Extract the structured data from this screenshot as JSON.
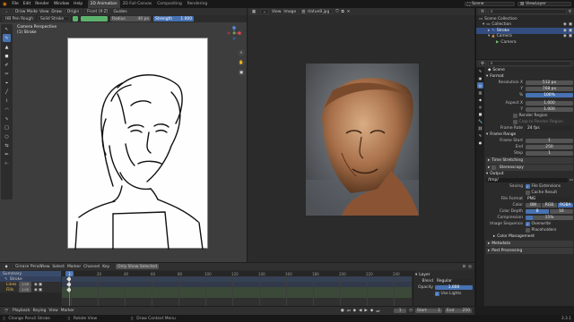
{
  "menu": [
    "File",
    "Edit",
    "Render",
    "Window",
    "Help"
  ],
  "workspace_tabs": [
    {
      "label": "2D Animation",
      "active": true
    },
    {
      "label": "2D Full Canvas",
      "active": false
    },
    {
      "label": "Compositing",
      "active": false
    },
    {
      "label": "Rendering",
      "active": false
    }
  ],
  "topbar_right": {
    "scene": "Scene",
    "view_layer": "ViewLayer"
  },
  "left_header": {
    "mode": "Draw Mode",
    "view": "View",
    "draw": "Draw",
    "origin": "Origin",
    "front": "Front (X-Z)",
    "guides": "Guides"
  },
  "tool_header": {
    "brush": "HB Pen Rough",
    "stroke": "Solid Stroke",
    "radius_label": "Radius",
    "radius_value": "40 px",
    "strength_label": "Strength",
    "strength_value": "1.000"
  },
  "viewport_info": {
    "line1": "Camera Perspective",
    "line2": "(1) Stroke"
  },
  "image_editor": {
    "view": "View",
    "image": "Image",
    "filename": "statue8.jpg"
  },
  "outliner": {
    "title": "Scene Collection",
    "items": [
      {
        "label": "Collection",
        "depth": 1,
        "selected": false
      },
      {
        "label": "Stroke",
        "depth": 2,
        "selected": true
      },
      {
        "label": "Camera",
        "depth": 1,
        "selected": false
      },
      {
        "label": "Camera",
        "depth": 2,
        "selected": false
      }
    ]
  },
  "properties": {
    "header": "Scene",
    "format": {
      "title": "Format",
      "rows": [
        {
          "label": "Resolution X",
          "value": "512 px",
          "blue": false
        },
        {
          "label": "Y",
          "value": "768 px",
          "blue": false
        },
        {
          "label": "%",
          "value": "100%",
          "blue": true
        },
        {
          "label": "Aspect X",
          "value": "1.000",
          "blue": false
        },
        {
          "label": "Y",
          "value": "1.000",
          "blue": false
        }
      ],
      "render_region": "Render Region",
      "crop_region": "Crop to Render Region",
      "frame_rate_label": "Frame Rate",
      "frame_rate_value": "24 fps"
    },
    "frame_range": {
      "title": "Frame Range",
      "rows": [
        {
          "label": "Frame Start",
          "value": "1"
        },
        {
          "label": "End",
          "value": "250"
        },
        {
          "label": "Step",
          "value": "1"
        }
      ]
    },
    "time_stretching": "Time Stretching",
    "stereoscopy": "Stereoscopy",
    "output": {
      "title": "Output",
      "path": "/tmp/",
      "saving_label": "Saving",
      "file_extensions": "File Extensions",
      "cache_result": "Cache Result",
      "file_format_label": "File Format",
      "file_format_value": "PNG",
      "color_label": "Color",
      "color_options": [
        "BW",
        "RGB",
        "RGBA"
      ],
      "color_selected": "RGBA",
      "color_depth_label": "Color Depth",
      "color_depth_options": [
        "8",
        "16"
      ],
      "color_depth_selected": "8",
      "compression_label": "Compression",
      "compression_value": "15%",
      "image_sequence_label": "Image Sequence",
      "overwrite": "Overwrite",
      "placeholders": "Placeholders",
      "color_management": "Color Management"
    },
    "metadata": "Metadata",
    "post_processing": "Post Processing"
  },
  "dopesheet": {
    "mode": "Grease Pencil",
    "menus": [
      "View",
      "Select",
      "Marker",
      "Channel",
      "Key"
    ],
    "only_show_selected": "Only Show Selected",
    "channels": [
      {
        "label": "Summary",
        "value": "",
        "kind": "summary"
      },
      {
        "label": "Stroke",
        "value": "",
        "kind": "object"
      },
      {
        "label": "Lines",
        "value": "1.00",
        "kind": "layer"
      },
      {
        "label": "Fills",
        "value": "1.00",
        "kind": "layer"
      }
    ],
    "frame_ticks": [
      "0",
      "20",
      "40",
      "60",
      "80",
      "100",
      "120",
      "140",
      "160",
      "180",
      "200",
      "220",
      "240"
    ],
    "current_frame": "1",
    "layer_panel": {
      "title": "Layer",
      "blend_label": "Blend",
      "blend_value": "Regular",
      "opacity_label": "Opacity",
      "opacity_value": "1.000",
      "use_lights": "Use Lights"
    }
  },
  "playback": {
    "playback": "Playback",
    "keying": "Keying",
    "view": "View",
    "marker": "Marker",
    "current": "1",
    "start_label": "Start",
    "start": "1",
    "end_label": "End",
    "end": "250"
  },
  "statusbar": {
    "left": "Change Pencil Stroke",
    "middle": "Rotate View",
    "right": "Draw Context Menu",
    "version": "3.3.1"
  },
  "colors": {
    "accent": "#4772b3",
    "selected": "#334d80",
    "playhead": "#4772b3"
  }
}
